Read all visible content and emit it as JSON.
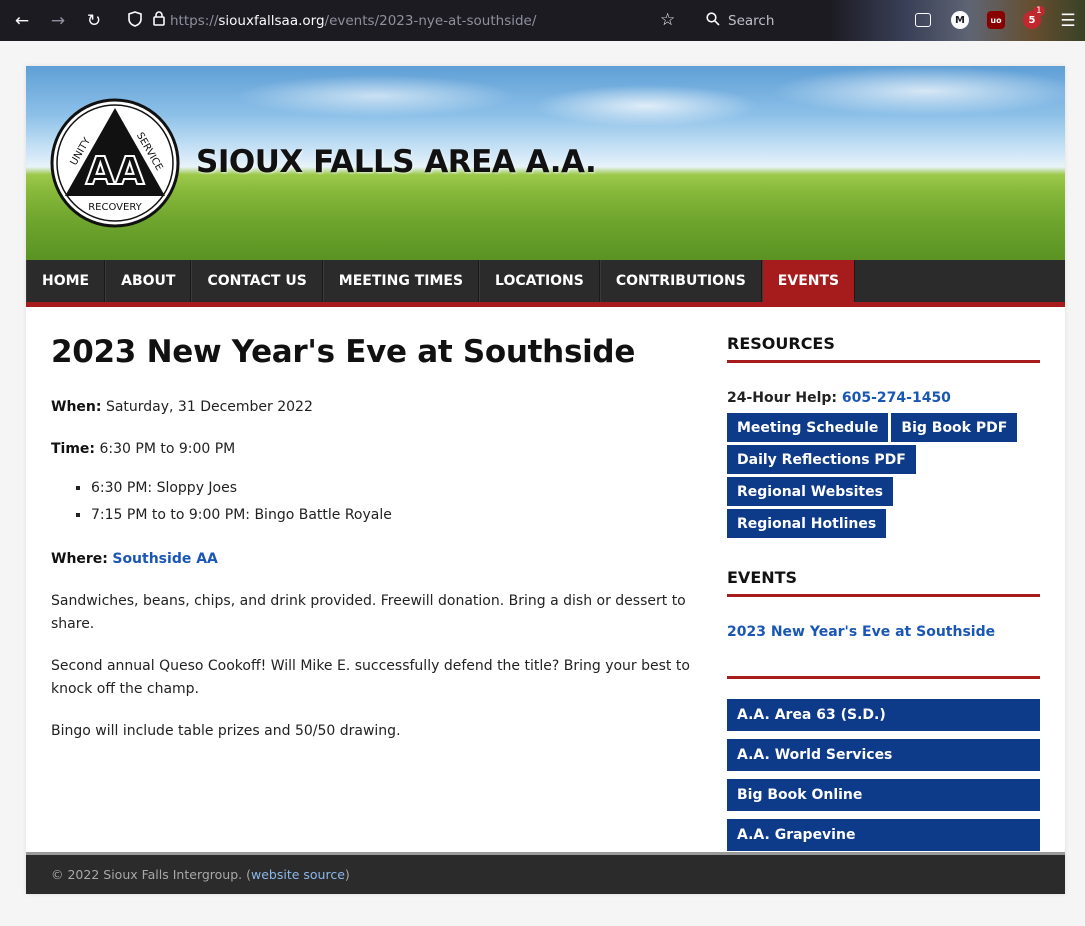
{
  "browser": {
    "url_prefix": "https://",
    "url_host": "siouxfallsaa.org",
    "url_path": "/events/2023-nye-at-southside/",
    "search_placeholder": "Search",
    "badge_count": "1"
  },
  "site": {
    "title": "SIOUX FALLS AREA A.A.",
    "logo_text": {
      "left": "UNITY",
      "right": "SERVICE",
      "bottom": "RECOVERY",
      "center": "AA"
    }
  },
  "nav": {
    "items": [
      "HOME",
      "ABOUT",
      "CONTACT US",
      "MEETING TIMES",
      "LOCATIONS",
      "CONTRIBUTIONS",
      "EVENTS"
    ],
    "active": "EVENTS"
  },
  "event": {
    "title": "2023 New Year's Eve at Southside",
    "when_label": "When:",
    "when_value": "Saturday, 31 December 2022",
    "time_label": "Time:",
    "time_value": "6:30 PM to 9:00 PM",
    "schedule": [
      "6:30 PM: Sloppy Joes",
      "7:15 PM to to 9:00 PM: Bingo Battle Royale"
    ],
    "where_label": "Where:",
    "where_value": "Southside AA",
    "para1": "Sandwiches, beans, chips, and drink provided. Freewill donation. Bring a dish or dessert to share.",
    "para2": "Second annual Queso Cookoff! Will Mike E. successfully defend the title? Bring your best to knock off the champ.",
    "para3": "Bingo will include table prizes and 50/50 drawing."
  },
  "sidebar": {
    "resources_heading": "RESOURCES",
    "help_label": "24-Hour Help:",
    "help_phone": "605-274-1450",
    "resource_buttons": [
      "Meeting Schedule",
      "Big Book PDF",
      "Daily Reflections PDF",
      "Regional Websites",
      "Regional Hotlines"
    ],
    "events_heading": "EVENTS",
    "event_link": "2023 New Year's Eve at Southside",
    "external_links": [
      "A.A. Area 63 (S.D.)",
      "A.A. World Services",
      "Big Book Online",
      "A.A. Grapevine"
    ]
  },
  "footer": {
    "copyright": "© 2022 Sioux Falls Intergroup. (",
    "source_link": "website source",
    "close": ")"
  },
  "colors": {
    "accent_red": "#a61c1c",
    "button_blue": "#0e3a8a",
    "link_blue": "#1a57b5",
    "nav_dark": "#2b2b2b"
  }
}
